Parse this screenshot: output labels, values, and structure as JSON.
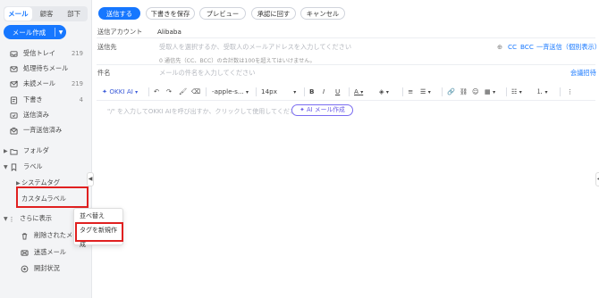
{
  "sidebar": {
    "tabs": [
      {
        "label": "メール",
        "active": true
      },
      {
        "label": "顧客",
        "active": false
      },
      {
        "label": "部下",
        "active": false
      }
    ],
    "compose_label": "メール作成",
    "folders": [
      {
        "label": "受信トレイ",
        "count": "219",
        "icon": "inbox-icon"
      },
      {
        "label": "処理待ちメール",
        "count": "",
        "icon": "pending-icon"
      },
      {
        "label": "未読メール",
        "count": "219",
        "icon": "unread-icon"
      },
      {
        "label": "下書き",
        "count": "4",
        "icon": "draft-icon"
      },
      {
        "label": "送信済み",
        "count": "",
        "icon": "sent-icon"
      },
      {
        "label": "一斉送信済み",
        "count": "",
        "icon": "bulk-sent-icon"
      }
    ],
    "folder_group": "フォルダ",
    "label_group": "ラベル",
    "system_tags": "システムタグ",
    "custom_label": "カスタムラベル",
    "more": "さらに表示",
    "more_items": [
      {
        "label": "削除されたメー",
        "icon": "trash-icon"
      },
      {
        "label": "迷惑メール",
        "icon": "spam-icon"
      },
      {
        "label": "開封状況",
        "icon": "open-status-icon"
      }
    ],
    "popup_menu": [
      "並べ替え",
      "タグを新規作成"
    ]
  },
  "actions": {
    "send": "送信する",
    "save_draft": "下書きを保存",
    "preview": "プレビュー",
    "approval": "承認に回す",
    "cancel": "キャンセル"
  },
  "form": {
    "account_label": "送信アカウント",
    "account_value": "Alibaba",
    "to_label": "送信先",
    "to_placeholder": "受取人を選択するか、受取人のメールアドレスを入力してください",
    "cc": "CC",
    "bcc": "BCC",
    "bulk_send": "一斉送信（個別表示）",
    "recipient_note": "0 通信先（CC、BCC）の合計数は100を超えてはいけません。",
    "subject_label": "件名",
    "subject_placeholder": "メールの件名を入力してください",
    "meeting_invite": "会議招待"
  },
  "editor_toolbar": {
    "ai_label": "OKKI AI",
    "font_family": "-apple-s...",
    "font_size": "14px"
  },
  "editor": {
    "placeholder": "\"/\" を入力してOKKI AIを呼び出すか、クリックして使用してください",
    "ai_compose": "AI メール作成"
  },
  "colors": {
    "accent": "#1677ff",
    "highlight_red": "#e02020",
    "ai_purple": "#6a5be6"
  }
}
